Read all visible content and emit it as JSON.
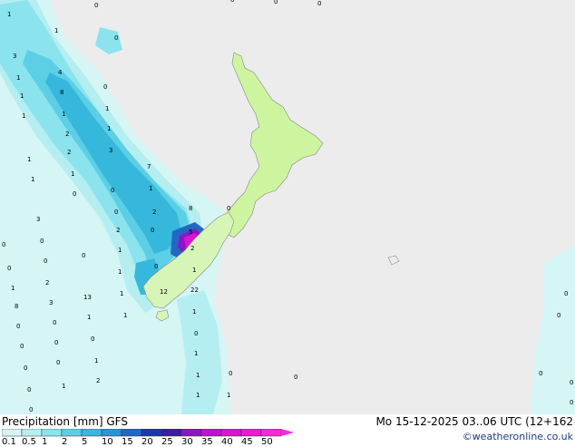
{
  "title": "Precipitation [mm] GFS",
  "datetime": "Mo 15-12-2025 03..06 UTC (12+162",
  "credit": "©weatheronline.co.uk",
  "colorbar": {
    "labels": [
      "0.1",
      "0.5",
      "1",
      "2",
      "5",
      "10",
      "15",
      "20",
      "25",
      "30",
      "35",
      "40",
      "45",
      "50"
    ],
    "colors": [
      "#d6f5f5",
      "#b4eef0",
      "#8be3ee",
      "#5ccfe6",
      "#36b8dd",
      "#2a93d2",
      "#2466c4",
      "#1c36b0",
      "#3a1ba8",
      "#8a16c8",
      "#c010d8",
      "#e012d2",
      "#f018d0",
      "#f828d8"
    ]
  },
  "colors": {
    "ocean": "#ececec",
    "land_north": "#cdf5a0",
    "light_precip": "#b4eef0",
    "medium_precip": "#8be3ee",
    "heavy_precip": "#5ccfe6",
    "very_heavy_precip": "#36b8dd",
    "extreme_precip": "#e012d2"
  },
  "map_values": [
    "1",
    "3",
    "1",
    "1",
    "1",
    "4",
    "8",
    "0",
    "1",
    "1",
    "1",
    "2",
    "2",
    "3",
    "7",
    "1",
    "1",
    "0",
    "1",
    "1",
    "0",
    "0",
    "2",
    "8",
    "3",
    "2",
    "0",
    "0",
    "0",
    "1",
    "0",
    "0",
    "5",
    "2",
    "0",
    "0",
    "1",
    "1",
    "12",
    "22",
    "2",
    "1",
    "13",
    "0",
    "1",
    "8",
    "3",
    "1",
    "1",
    "1",
    "0",
    "0",
    "0",
    "0",
    "0",
    "0",
    "0",
    "1",
    "1",
    "0",
    "2",
    "0",
    "1",
    "1",
    "0",
    "1",
    "1",
    "0",
    "0",
    "0",
    "0",
    "0",
    "0",
    "0",
    "0",
    "0",
    "0",
    "1",
    "0",
    "0"
  ]
}
